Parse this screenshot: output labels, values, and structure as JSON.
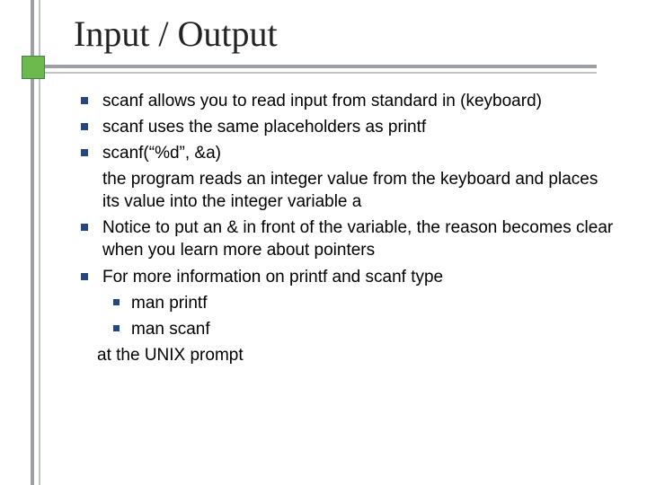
{
  "title": "Input / Output",
  "bullets": {
    "b1": "scanf allows you to read input from standard in (keyboard)",
    "b2": "scanf uses the same placeholders as printf",
    "b3": "scanf(“%d”, &a)",
    "b3_cont": "the program reads an integer value from the keyboard and places its value into the integer variable a",
    "b4": "Notice to put an & in front of the variable, the reason becomes clear when you learn more about pointers",
    "b5": "For more information on printf and scanf type",
    "b5_sub1": "man printf",
    "b5_sub2": "man scanf",
    "b5_cont": "at the UNIX prompt"
  }
}
